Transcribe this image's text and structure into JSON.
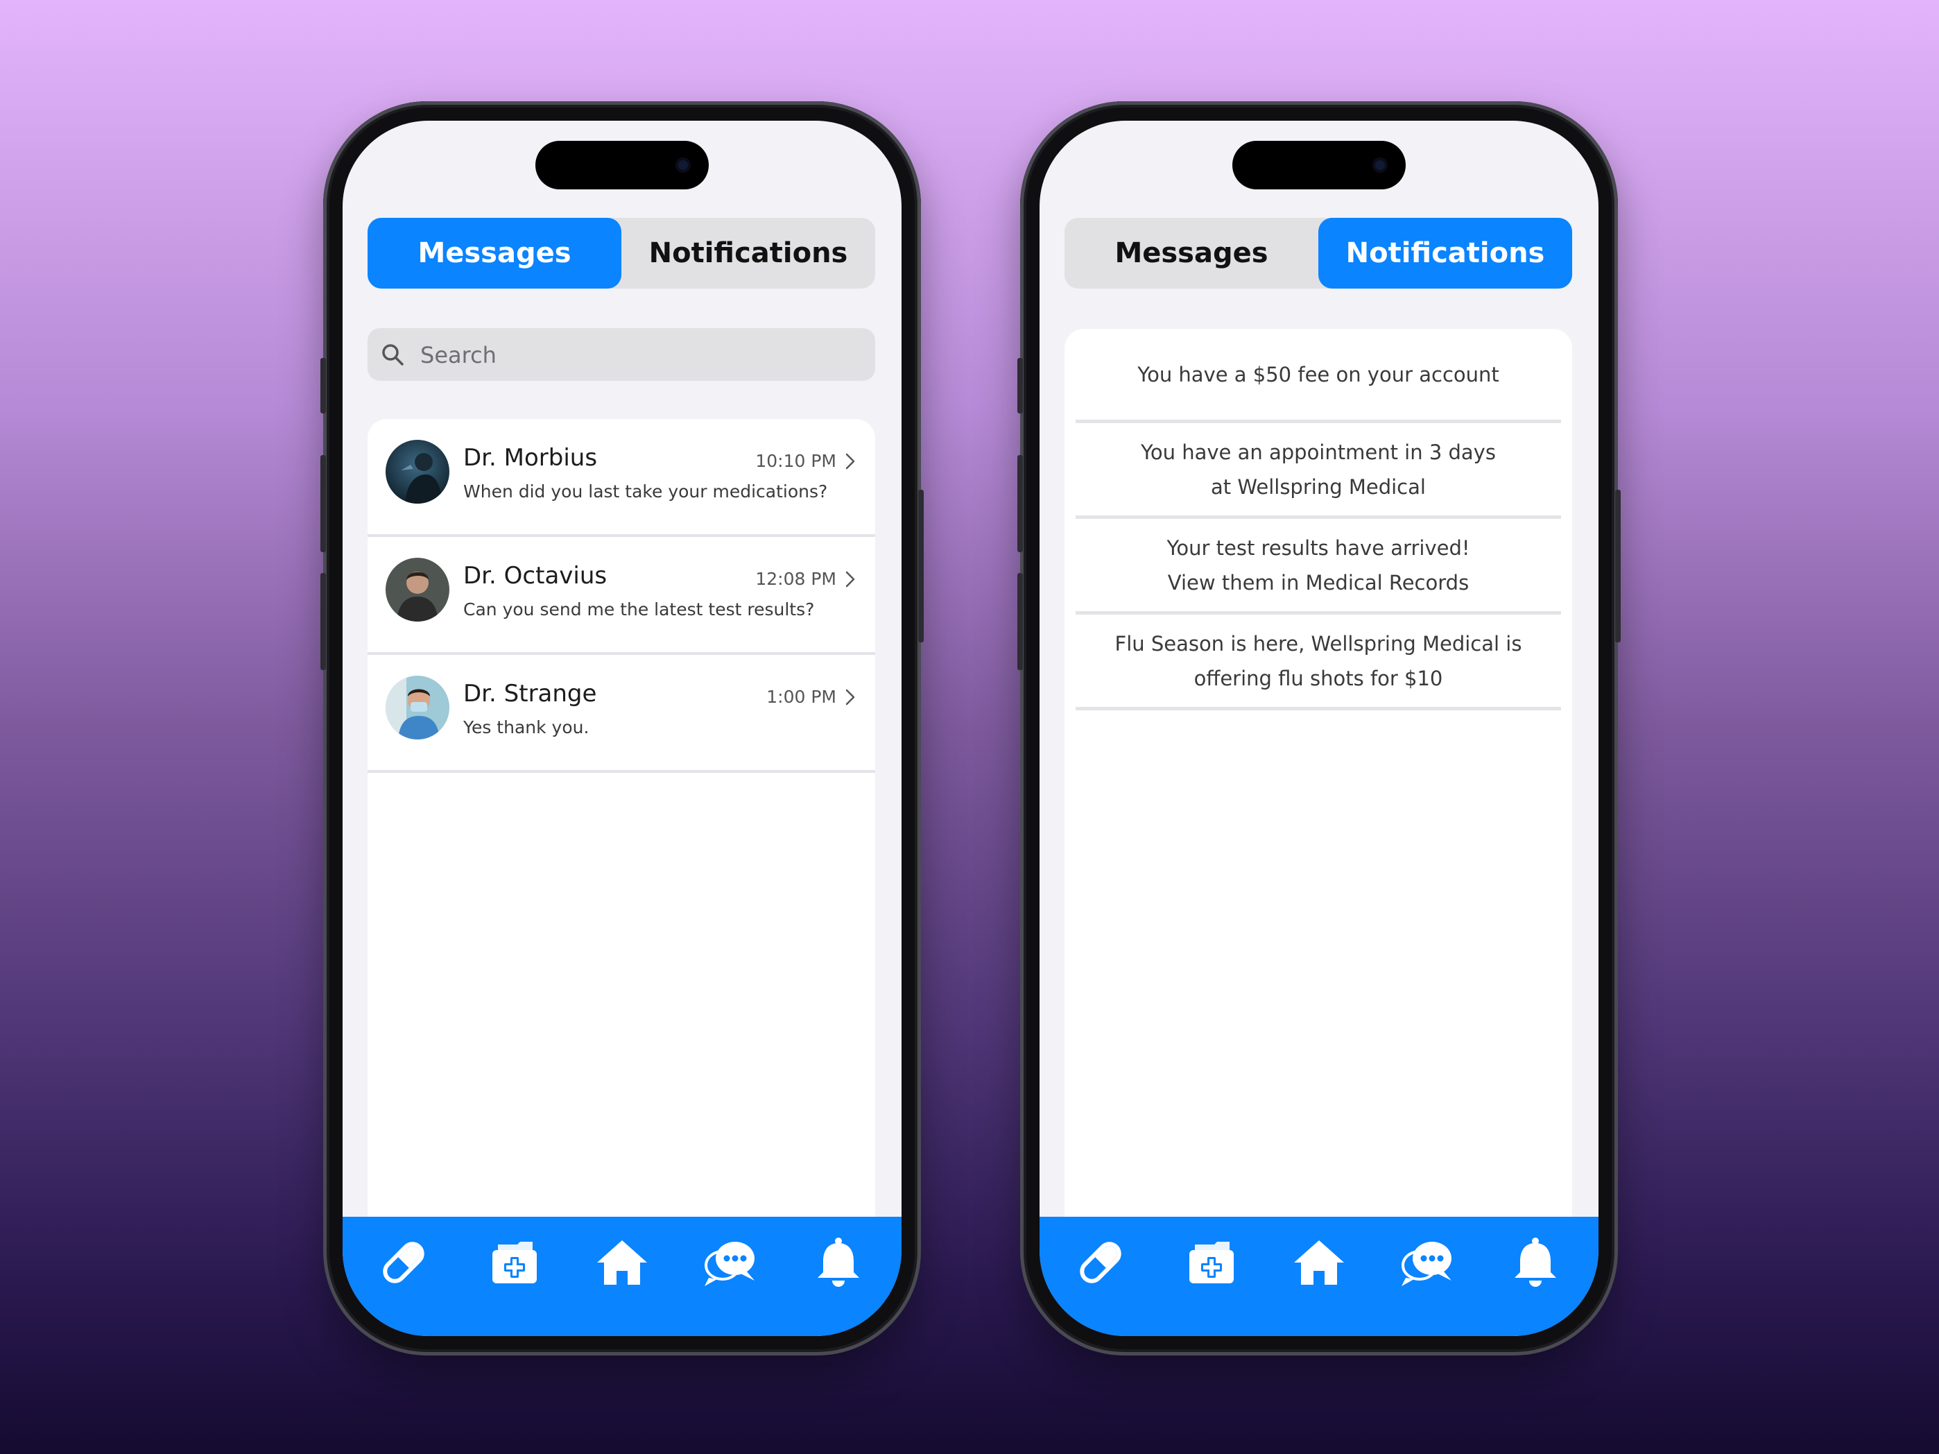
{
  "colors": {
    "accent": "#0a84ff",
    "screen_bg": "#f2f2f7",
    "segment_bg": "#e1e1e4",
    "divider": "#e3e3e8"
  },
  "tabs": {
    "messages": "Messages",
    "notifications": "Notifications"
  },
  "messages_screen": {
    "active_tab": "messages",
    "search": {
      "placeholder": "Search",
      "icon": "search-icon"
    },
    "conversations": [
      {
        "name": "Dr. Morbius",
        "time": "10:10 PM",
        "preview": "When did you last take your medications?",
        "avatar": "avatar"
      },
      {
        "name": "Dr. Octavius",
        "time": "12:08 PM",
        "preview": "Can you send me the latest test results?",
        "avatar": "avatar"
      },
      {
        "name": "Dr. Strange",
        "time": "1:00 PM",
        "preview": "Yes thank you.",
        "avatar": "avatar"
      }
    ]
  },
  "notifications_screen": {
    "active_tab": "notifications",
    "items": [
      {
        "line1": "You have a $50 fee on your account",
        "line2": ""
      },
      {
        "line1": "You have an appointment in 3 days",
        "line2": "at Wellspring Medical"
      },
      {
        "line1": "Your test results have arrived!",
        "line2": "View them in Medical Records"
      },
      {
        "line1": "Flu Season is here, Wellspring Medical is",
        "line2": "offering flu shots for $10"
      }
    ]
  },
  "navbar": {
    "items": [
      {
        "id": "pill",
        "icon": "pill-icon"
      },
      {
        "id": "records",
        "icon": "medical-folder-icon"
      },
      {
        "id": "home",
        "icon": "home-icon"
      },
      {
        "id": "chat",
        "icon": "chat-bubbles-icon"
      },
      {
        "id": "bell",
        "icon": "bell-icon"
      }
    ]
  }
}
